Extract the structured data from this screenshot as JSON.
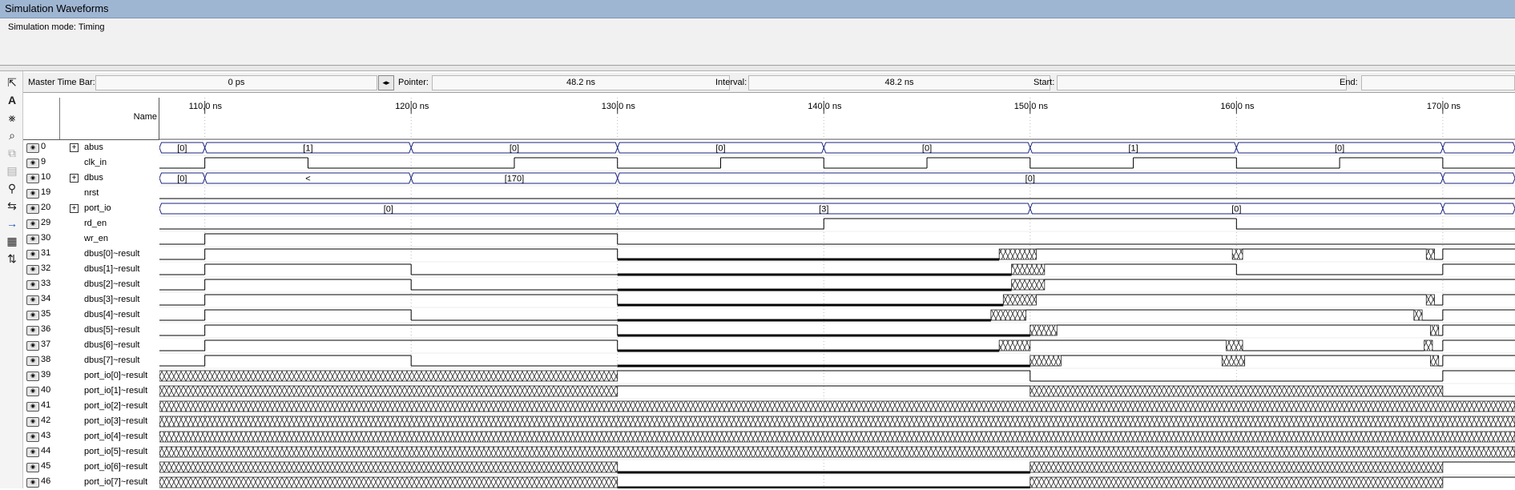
{
  "window": {
    "title": "Simulation Waveforms",
    "mode_text": "Simulation mode: Timing"
  },
  "toolbar": {
    "icons": [
      "select-pointer-icon",
      "text-tool-icon",
      "waveform-editing-icon",
      "zoom-icon",
      "copy-icon",
      "paste-icon",
      "find-icon",
      "replace-icon",
      "goto-arrow-icon",
      "group-icon",
      "sort-icon"
    ]
  },
  "timebar": {
    "master_label": "Master Time Bar:",
    "master_value": "0 ps",
    "pointer_label": "Pointer:",
    "pointer_value": "48.2 ns",
    "interval_label": "Interval:",
    "interval_value": "48.2 ns",
    "start_label": "Start:",
    "start_value": "",
    "end_label": "End:",
    "end_value": ""
  },
  "name_header": "Name",
  "time_axis": {
    "start_ns": 107.8,
    "end_ns": 173.5,
    "ticks": [
      {
        "t": 110,
        "label": "110,0 ns"
      },
      {
        "t": 120,
        "label": "120,0 ns"
      },
      {
        "t": 130,
        "label": "130,0 ns"
      },
      {
        "t": 140,
        "label": "140,0 ns"
      },
      {
        "t": 150,
        "label": "150,0 ns"
      },
      {
        "t": 160,
        "label": "160,0 ns"
      },
      {
        "t": 170,
        "label": "170,0 ns"
      }
    ]
  },
  "signals": [
    {
      "id": "0",
      "name": "abus",
      "bus": true,
      "segments": [
        [
          107.8,
          110,
          "[0]"
        ],
        [
          110,
          120,
          "[1]"
        ],
        [
          120,
          130,
          "[0]"
        ],
        [
          130,
          140,
          "[0]"
        ],
        [
          140,
          150,
          "[0]"
        ],
        [
          150,
          160,
          "[1]"
        ],
        [
          160,
          170,
          "[0]"
        ],
        [
          170,
          173.5,
          ""
        ]
      ]
    },
    {
      "id": "9",
      "name": "clk_in",
      "bus": false,
      "level": [
        [
          107.8,
          0
        ],
        [
          110,
          1
        ],
        [
          115,
          0
        ],
        [
          125,
          1
        ],
        [
          130,
          0
        ],
        [
          135,
          1
        ],
        [
          140,
          0
        ],
        [
          145,
          1
        ],
        [
          150,
          0
        ],
        [
          155,
          1
        ],
        [
          160,
          0
        ],
        [
          165,
          1
        ],
        [
          170,
          0
        ]
      ]
    },
    {
      "id": "10",
      "name": "dbus",
      "bus": true,
      "segments": [
        [
          107.8,
          110,
          "[0]"
        ],
        [
          110,
          120,
          "<"
        ],
        [
          120,
          130,
          "[170]"
        ],
        [
          130,
          170,
          "[0]"
        ],
        [
          170,
          173.5,
          ""
        ]
      ]
    },
    {
      "id": "19",
      "name": "nrst",
      "bus": false,
      "level": [
        [
          107.8,
          0
        ]
      ]
    },
    {
      "id": "20",
      "name": "port_io",
      "bus": true,
      "segments": [
        [
          107.8,
          130,
          "[0]"
        ],
        [
          130,
          150,
          "[3]"
        ],
        [
          150,
          170,
          "[0]"
        ],
        [
          170,
          173.5,
          ""
        ]
      ]
    },
    {
      "id": "29",
      "name": "rd_en",
      "bus": false,
      "level": [
        [
          107.8,
          0
        ],
        [
          140,
          1
        ],
        [
          160,
          0
        ]
      ]
    },
    {
      "id": "30",
      "name": "wr_en",
      "bus": false,
      "level": [
        [
          107.8,
          0
        ],
        [
          110,
          1
        ],
        [
          130,
          0
        ]
      ]
    },
    {
      "id": "31",
      "name": "dbus[0]~result",
      "bus": false,
      "level": [
        [
          107.8,
          0
        ],
        [
          110,
          1
        ],
        [
          130,
          0
        ],
        [
          148.5,
          "x"
        ],
        [
          150.3,
          1
        ],
        [
          159.8,
          "x"
        ],
        [
          160.3,
          1
        ],
        [
          169.2,
          "x"
        ],
        [
          169.6,
          0
        ],
        [
          170,
          1
        ]
      ]
    },
    {
      "id": "32",
      "name": "dbus[1]~result",
      "bus": false,
      "level": [
        [
          107.8,
          0
        ],
        [
          110,
          1
        ],
        [
          120,
          0
        ],
        [
          130,
          0
        ],
        [
          149.1,
          "x"
        ],
        [
          150.7,
          1
        ],
        [
          160,
          0
        ],
        [
          170,
          1
        ]
      ]
    },
    {
      "id": "33",
      "name": "dbus[2]~result",
      "bus": false,
      "level": [
        [
          107.8,
          0
        ],
        [
          110,
          1
        ],
        [
          120,
          0
        ],
        [
          130,
          0
        ],
        [
          149.1,
          "x"
        ],
        [
          150.7,
          1
        ],
        [
          170,
          1
        ]
      ]
    },
    {
      "id": "34",
      "name": "dbus[3]~result",
      "bus": false,
      "level": [
        [
          107.8,
          0
        ],
        [
          110,
          1
        ],
        [
          130,
          0
        ],
        [
          148.7,
          "x"
        ],
        [
          150.3,
          1
        ],
        [
          169.2,
          "x"
        ],
        [
          169.6,
          0
        ],
        [
          170,
          1
        ]
      ]
    },
    {
      "id": "35",
      "name": "dbus[4]~result",
      "bus": false,
      "level": [
        [
          107.8,
          0
        ],
        [
          110,
          1
        ],
        [
          120,
          0
        ],
        [
          130,
          0
        ],
        [
          148.1,
          "x"
        ],
        [
          149.8,
          1
        ],
        [
          168.6,
          "x"
        ],
        [
          169,
          0
        ],
        [
          170,
          1
        ]
      ]
    },
    {
      "id": "36",
      "name": "dbus[5]~result",
      "bus": false,
      "level": [
        [
          107.8,
          0
        ],
        [
          110,
          1
        ],
        [
          130,
          0
        ],
        [
          150,
          "x"
        ],
        [
          151.3,
          1
        ],
        [
          169.4,
          "x"
        ],
        [
          169.8,
          0
        ],
        [
          170,
          1
        ]
      ]
    },
    {
      "id": "37",
      "name": "dbus[6]~result",
      "bus": false,
      "level": [
        [
          107.8,
          0
        ],
        [
          110,
          1
        ],
        [
          130,
          0
        ],
        [
          148.5,
          "x"
        ],
        [
          150,
          1
        ],
        [
          159.5,
          "x"
        ],
        [
          160.3,
          0
        ],
        [
          169.1,
          "x"
        ],
        [
          169.5,
          0
        ],
        [
          170,
          1
        ]
      ]
    },
    {
      "id": "38",
      "name": "dbus[7]~result",
      "bus": false,
      "level": [
        [
          107.8,
          0
        ],
        [
          110,
          1
        ],
        [
          120,
          0
        ],
        [
          130,
          0
        ],
        [
          150,
          "x"
        ],
        [
          151.5,
          1
        ],
        [
          159.3,
          "x"
        ],
        [
          160.4,
          1
        ],
        [
          169.4,
          "x"
        ],
        [
          169.8,
          0
        ],
        [
          170,
          1
        ]
      ]
    },
    {
      "id": "39",
      "name": "port_io[0]~result",
      "bus": false,
      "level": [
        [
          107.8,
          "x"
        ],
        [
          130,
          1
        ],
        [
          150,
          0
        ],
        [
          170,
          1
        ]
      ]
    },
    {
      "id": "40",
      "name": "port_io[1]~result",
      "bus": false,
      "level": [
        [
          107.8,
          "x"
        ],
        [
          130,
          1
        ],
        [
          150,
          "x"
        ],
        [
          170,
          0
        ]
      ]
    },
    {
      "id": "41",
      "name": "port_io[2]~result",
      "bus": false,
      "level": [
        [
          107.8,
          "x"
        ]
      ]
    },
    {
      "id": "42",
      "name": "port_io[3]~result",
      "bus": false,
      "level": [
        [
          107.8,
          "x"
        ]
      ]
    },
    {
      "id": "43",
      "name": "port_io[4]~result",
      "bus": false,
      "level": [
        [
          107.8,
          "x"
        ]
      ]
    },
    {
      "id": "44",
      "name": "port_io[5]~result",
      "bus": false,
      "level": [
        [
          107.8,
          "x"
        ]
      ]
    },
    {
      "id": "45",
      "name": "port_io[6]~result",
      "bus": false,
      "level": [
        [
          107.8,
          "x"
        ],
        [
          130,
          0
        ],
        [
          150,
          "x"
        ],
        [
          170,
          1
        ]
      ]
    },
    {
      "id": "46",
      "name": "port_io[7]~result",
      "bus": false,
      "level": [
        [
          107.8,
          "x"
        ],
        [
          130,
          0
        ],
        [
          150,
          "x"
        ],
        [
          170,
          1
        ]
      ]
    }
  ]
}
